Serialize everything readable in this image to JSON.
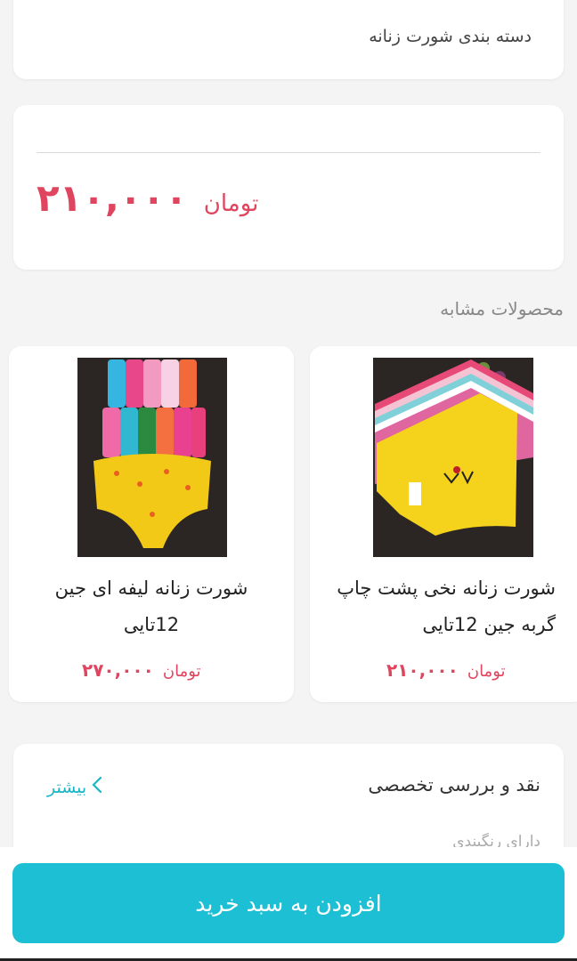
{
  "category": {
    "label": "دسته بندی شورت زنانه"
  },
  "price": {
    "amount": "۲۱۰,۰۰۰",
    "currency": "تومان"
  },
  "similar": {
    "title": "محصولات مشابه",
    "products": [
      {
        "name": "شورت زنانه نخی پشت چاپ گربه جین 12تایی",
        "amount": "۲۱۰,۰۰۰",
        "currency": "تومان"
      },
      {
        "name": "شورت زنانه لیفه ای جین 12تایی",
        "amount": "۲۷۰,۰۰۰",
        "currency": "تومان"
      }
    ]
  },
  "review": {
    "title": "نقد و بررسی تخصصی",
    "more_label": "بیشتر",
    "subtitle": "دارای رنگبندی"
  },
  "cart": {
    "button_label": "افزودن به سبد خرید"
  },
  "colors": {
    "accent": "#1cbfd3",
    "price": "#e0455f"
  }
}
